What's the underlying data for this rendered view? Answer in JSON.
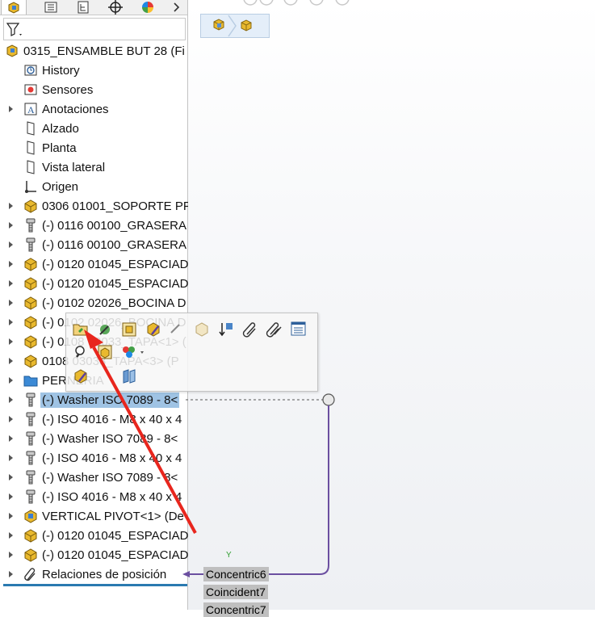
{
  "filter": {
    "icon": "filter-icon"
  },
  "tabs": [
    {
      "name": "tab-feature-manager",
      "icon": "assembly-icon"
    },
    {
      "name": "tab-property-manager",
      "icon": "list-icon"
    },
    {
      "name": "tab-configuration-manager",
      "icon": "config-icon"
    },
    {
      "name": "tab-dimxpert",
      "icon": "crosshair-icon"
    },
    {
      "name": "tab-display-manager",
      "icon": "color-wheel-icon"
    }
  ],
  "tree": {
    "root": "0315_ENSAMBLE BUT 28  (Fi",
    "items": [
      {
        "label": "History",
        "icon": "history-icon",
        "expand": false
      },
      {
        "label": "Sensores",
        "icon": "sensor-icon",
        "expand": false
      },
      {
        "label": "Anotaciones",
        "icon": "annotation-icon",
        "expand": true
      },
      {
        "label": "Alzado",
        "icon": "plane-icon",
        "expand": false
      },
      {
        "label": "Planta",
        "icon": "plane-icon",
        "expand": false
      },
      {
        "label": "Vista lateral",
        "icon": "plane-icon",
        "expand": false
      },
      {
        "label": "Origen",
        "icon": "origin-icon",
        "expand": false
      },
      {
        "label": "0306 01001_SOPORTE PF",
        "icon": "part-icon",
        "expand": true
      },
      {
        "label": "(-) 0116 00100_GRASERA",
        "icon": "bolt-icon",
        "expand": true
      },
      {
        "label": "(-) 0116 00100_GRASERA",
        "icon": "bolt-icon",
        "expand": true
      },
      {
        "label": "(-) 0120 01045_ESPACIAD",
        "icon": "part-icon",
        "expand": true
      },
      {
        "label": "(-) 0120 01045_ESPACIAD",
        "icon": "part-icon",
        "expand": true
      },
      {
        "label": "(-) 0102 02026_BOCINA D",
        "icon": "part-icon",
        "expand": true
      },
      {
        "label": "(-) 0102 02026_BOCINA D",
        "icon": "part-icon",
        "expand": true
      },
      {
        "label": "(-) 0108 03033_TAPA<1> (",
        "icon": "part-icon",
        "expand": true
      },
      {
        "label": "0108 03033_TAPA<3> (P",
        "icon": "part-icon",
        "expand": true
      },
      {
        "label": "PERNERIA",
        "icon": "folder-icon",
        "expand": true
      },
      {
        "label": "(-) Washer ISO 7089 - 8<",
        "icon": "bolt-icon",
        "expand": true,
        "selected": true
      },
      {
        "label": "(-) ISO 4016 - M8 x 40 x 4",
        "icon": "bolt-icon",
        "expand": true
      },
      {
        "label": "(-) Washer ISO 7089 - 8<",
        "icon": "bolt-icon",
        "expand": true
      },
      {
        "label": "(-) ISO 4016 - M8 x 40 x 4",
        "icon": "bolt-icon",
        "expand": true
      },
      {
        "label": "(-) Washer ISO 7089 - 8<",
        "icon": "bolt-icon",
        "expand": true
      },
      {
        "label": "(-) ISO 4016 - M8 x 40 x 4",
        "icon": "bolt-icon",
        "expand": true
      },
      {
        "label": "VERTICAL PIVOT<1> (De",
        "icon": "assembly-icon",
        "expand": true
      },
      {
        "label": "(-) 0120 01045_ESPACIAD",
        "icon": "part-icon",
        "expand": true
      },
      {
        "label": "(-) 0120 01045_ESPACIAD",
        "icon": "part-icon",
        "expand": true
      },
      {
        "label": "Relaciones de posición",
        "icon": "mate-icon",
        "expand": true
      }
    ]
  },
  "context_toolbar": {
    "row1": [
      "open-part-icon",
      "rebuild-icon",
      "open-assembly-icon",
      "edit-part-icon",
      "smart-mates-icon",
      "hide-icon",
      "reorder-icon",
      "paperclip-icon",
      "mates-icon",
      "properties-icon"
    ],
    "row2": [
      "zoom-to-selection-icon",
      "isolate-icon",
      "appearance-icon"
    ],
    "row3": [
      "edit-feature-icon",
      "component-properties-icon"
    ]
  },
  "relations": [
    "Concentric6",
    "Coincident7",
    "Concentric7"
  ],
  "axis_label": "Y",
  "colors": {
    "selection": "#9fc3e4",
    "arrow": "#e8261d",
    "mate_line": "#6b4fa0",
    "part_yellow": "#e9b92e"
  }
}
